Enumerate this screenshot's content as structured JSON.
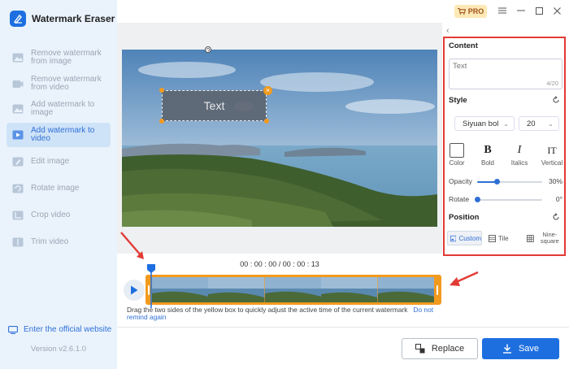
{
  "app": {
    "title": "Watermark Eraser",
    "version": "Version v2.6.1.0",
    "official_link": "Enter the official website"
  },
  "sidebar": {
    "items": [
      {
        "label": "Remove watermark from image",
        "icon": "remove-image-icon",
        "active": false
      },
      {
        "label": "Remove watermark from video",
        "icon": "remove-video-icon",
        "active": false
      },
      {
        "label": "Add watermark to image",
        "icon": "add-image-icon",
        "active": false
      },
      {
        "label": "Add watermark to video",
        "icon": "add-video-icon",
        "active": true
      },
      {
        "label": "Edit image",
        "icon": "edit-image-icon",
        "active": false
      },
      {
        "label": "Rotate image",
        "icon": "rotate-image-icon",
        "active": false
      },
      {
        "label": "Crop video",
        "icon": "crop-video-icon",
        "active": false
      },
      {
        "label": "Trim video",
        "icon": "trim-video-icon",
        "active": false
      }
    ]
  },
  "topbar": {
    "pro_label": "PRO",
    "icons": [
      "cart-icon",
      "menu-icon",
      "minimize-icon",
      "maximize-icon",
      "close-icon"
    ]
  },
  "preview": {
    "watermark_text": "Text"
  },
  "timeline": {
    "timecode": "00 : 00 : 00 / 00 : 00 : 13",
    "hint": "Drag the two sides of the yellow box to quickly adjust the active time of the current watermark",
    "hint_link": "Do not remind again"
  },
  "panel": {
    "content_heading": "Content",
    "content_placeholder": "Text",
    "char_count": "4/20",
    "style_heading": "Style",
    "font_family": "Siyuan bol",
    "font_size": "20",
    "color_label": "Color",
    "bold_label": "Bold",
    "italics_label": "Italics",
    "vertical_label": "Vertical",
    "bold_glyph": "B",
    "italics_glyph": "I",
    "vertical_glyph": "IT",
    "opacity_label": "Opacity",
    "opacity_value": "30%",
    "opacity_level": 0.3,
    "rotate_label": "Rotate",
    "rotate_value": "0°",
    "rotate_level": 0.0,
    "position_heading": "Position",
    "position_options": [
      "Custom",
      "Tile",
      "Nine-square"
    ],
    "position_selected": "Custom"
  },
  "buttons": {
    "replace": "Replace",
    "save": "Save"
  },
  "colors": {
    "accent": "#1d6fe0",
    "timeline_frame": "#f29a1e",
    "annotation_red": "#e23b35",
    "sidebar_bg": "#eaf3fc"
  }
}
